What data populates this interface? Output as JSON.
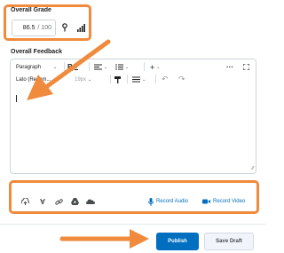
{
  "grade": {
    "label": "Overall Grade",
    "value": "86.5",
    "out_of": "/ 100",
    "icons": [
      "key-icon",
      "bar-chart-icon"
    ]
  },
  "feedback": {
    "label": "Overall Feedback",
    "toolbar": {
      "paragraph": "Paragraph",
      "bold_icon": "bold-icon",
      "align_icon": "align-icon",
      "list_icon": "bulleted-list-icon",
      "insert_icon": "plus-icon",
      "more_icon": "more-options-icon",
      "fullscreen_icon": "fullscreen-icon",
      "font": "Lato (Recom...",
      "size": "19px",
      "format_painter_icon": "format-painter-icon",
      "spacing_icon": "line-spacing-icon",
      "undo_icon": "undo-icon",
      "redo_icon": "redo-icon"
    },
    "body_text": ""
  },
  "attachments": {
    "icons": [
      "upload-icon",
      "insert-stuff-icon",
      "link-icon",
      "google-drive-icon",
      "onedrive-icon"
    ],
    "record_audio": "Record Audio",
    "record_video": "Record Video"
  },
  "actions": {
    "publish": "Publish",
    "save_draft": "Save Draft"
  },
  "colors": {
    "accent": "#006fbf",
    "highlight": "#f08a3c"
  }
}
